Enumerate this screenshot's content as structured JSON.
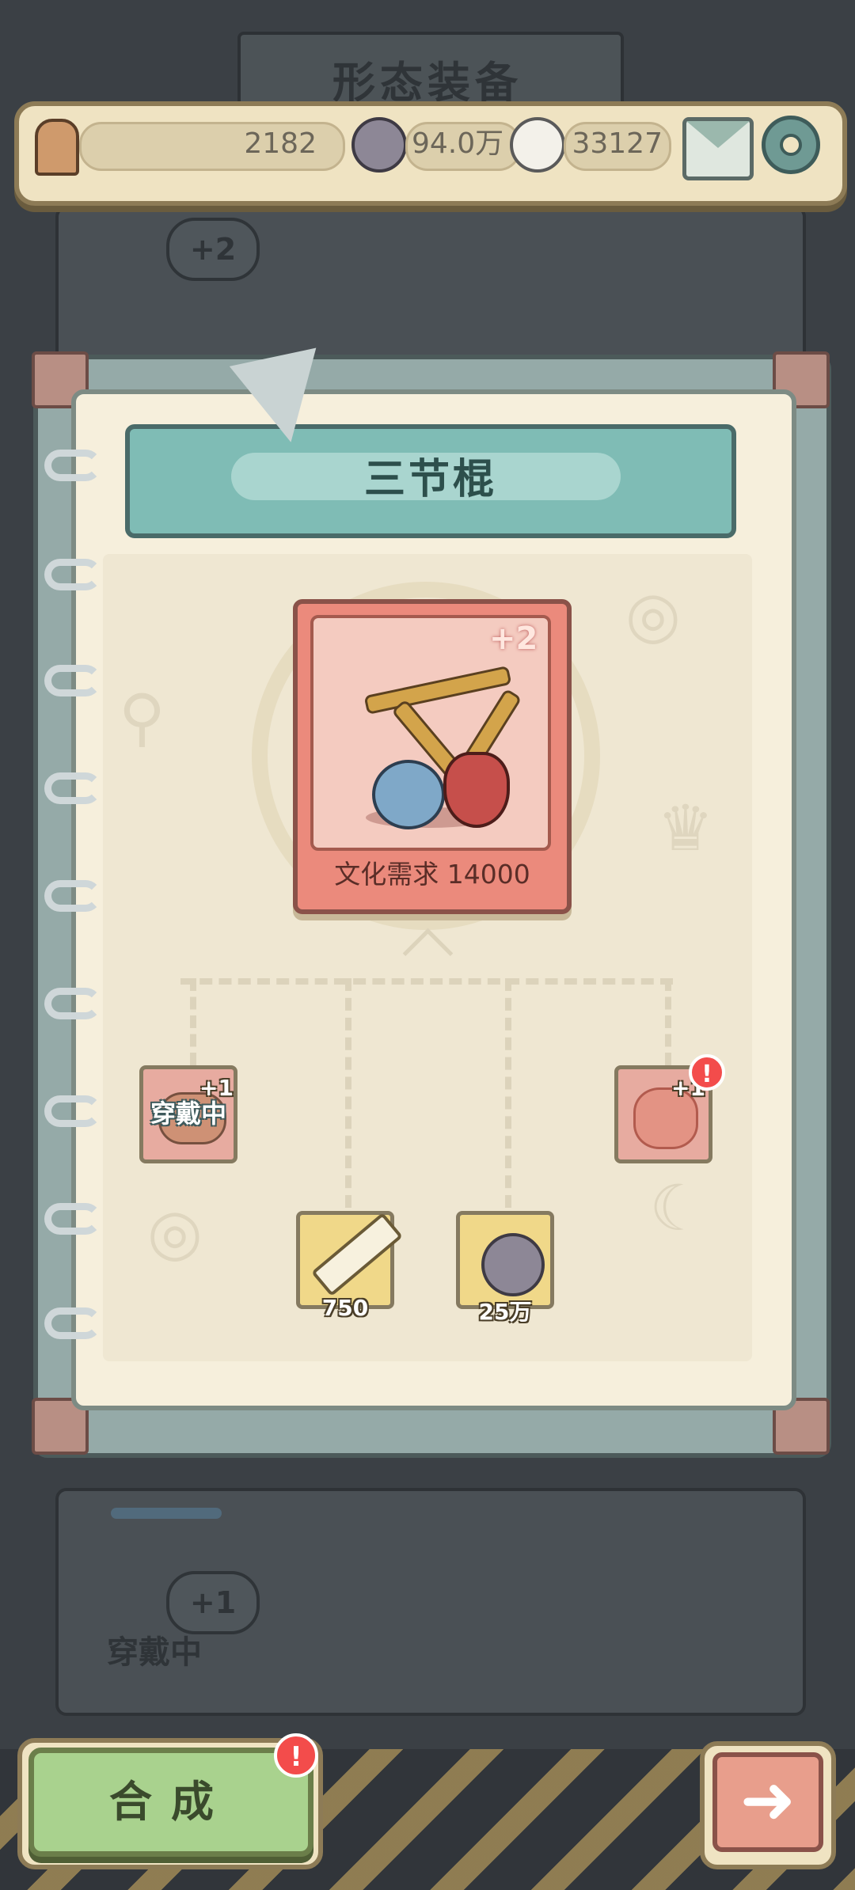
{
  "background": {
    "title": "形态装备",
    "upper_bubble": "+2",
    "lower_bubble": "+1",
    "lower_worn_label": "穿戴中"
  },
  "resources": {
    "culture": "2182",
    "soul_gray": "94.0万",
    "soul_white": "33127"
  },
  "item": {
    "name": "三节棍",
    "level_badge": "+2",
    "requirement": "文化需求 14000"
  },
  "materials": {
    "left_slot_badge": "+1",
    "left_slot_status": "穿戴中",
    "right_slot_badge": "+1",
    "right_slot_alert": "!",
    "tube_qty": "750",
    "ghost_qty": "25万"
  },
  "actions": {
    "synthesize": "合成",
    "synthesize_alert": "!",
    "next_arrow": "➜"
  },
  "colors": {
    "card": "#eb8a7c",
    "title_plate": "#7fbcb5",
    "synth_button": "#a9d28e",
    "alert": "#f34c4b"
  }
}
